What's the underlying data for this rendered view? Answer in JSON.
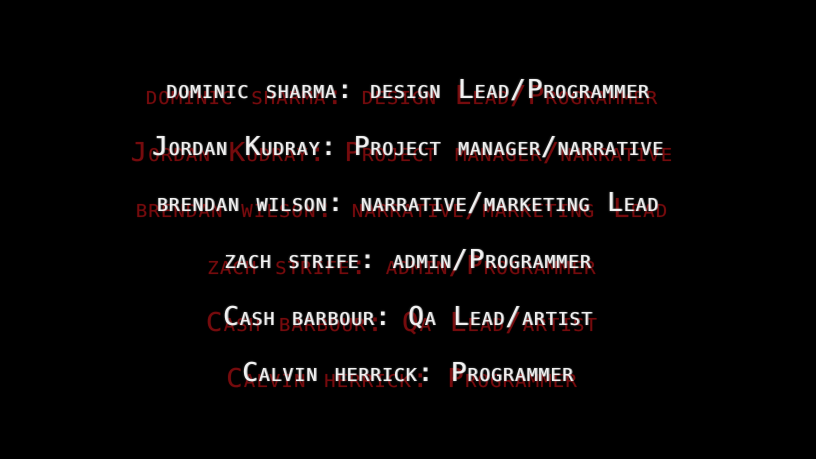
{
  "credits": [
    {
      "text": "dominic sharma: design Lead/Programmer"
    },
    {
      "text": "Jordan Kudray: Project manager/narrative"
    },
    {
      "text": "brendan wilson: narrative/marketing Lead"
    },
    {
      "text": "zach strife: admin/Programmer"
    },
    {
      "text": "Cash barbour: Qa Lead/artist"
    },
    {
      "text": "Calvin herrick: Programmer"
    }
  ],
  "colors": {
    "background": "#000000",
    "text": "#f2f2f2",
    "shadow": "#8a0d10"
  }
}
